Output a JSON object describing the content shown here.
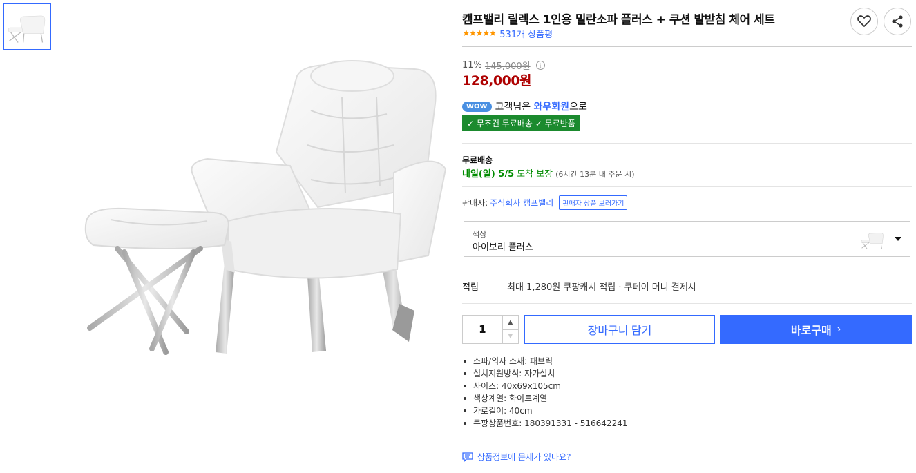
{
  "gallery": {
    "thumbnail_icon": "chair-thumbnail",
    "main_image_icon": "lounge-chair-with-ottoman"
  },
  "product": {
    "title": "캠프밸리 릴렉스 1인용 밀란소파 플러스 + 쿠션 발받침 체어 세트",
    "stars": "★★★★★",
    "review_count": "531개 상품평",
    "discount_rate": "11%",
    "original_price": "145,000원",
    "price": "128,000원"
  },
  "actions": {
    "wishlist_icon": "heart-icon",
    "share_icon": "share-icon"
  },
  "wow": {
    "badge": "WOW",
    "text_before": "고객님은 ",
    "link": "와우회원",
    "text_after": "으로",
    "benefits": "✓ 무조건 무료배송 ✓ 무료반품"
  },
  "shipping": {
    "title": "무료배송",
    "date": "내일(일) 5/5",
    "guarantee": "도착 보장",
    "condition": "(6시간 13분 내 주문 시)"
  },
  "seller": {
    "label": "판매자:",
    "name": "주식회사 캠프밸리",
    "button": "판매자 상품 보러가기"
  },
  "option": {
    "label": "색상",
    "value": "아이보리 플러스"
  },
  "points": {
    "label": "적립",
    "text_before": "최대 1,280원 ",
    "link": "쿠팡캐시 적립",
    "text_after": " · 쿠페이 머니 결제시"
  },
  "purchase": {
    "quantity": "1",
    "cart_label": "장바구니 담기",
    "buy_label": "바로구매",
    "buy_chevron": "›"
  },
  "specs": [
    "소파/의자 소재: 패브릭",
    "설치지원방식: 자가설치",
    "사이즈: 40x69x105cm",
    "색상계열: 화이트계열",
    "가로길이: 40cm",
    "쿠팡상품번호: 180391331 - 516642241"
  ],
  "report": {
    "text": "상품정보에 문제가 있나요?"
  },
  "colors": {
    "accent": "#346aff",
    "price": "#ae0000",
    "free_shipping": "#1b8a2e",
    "star": "#ff9600"
  }
}
